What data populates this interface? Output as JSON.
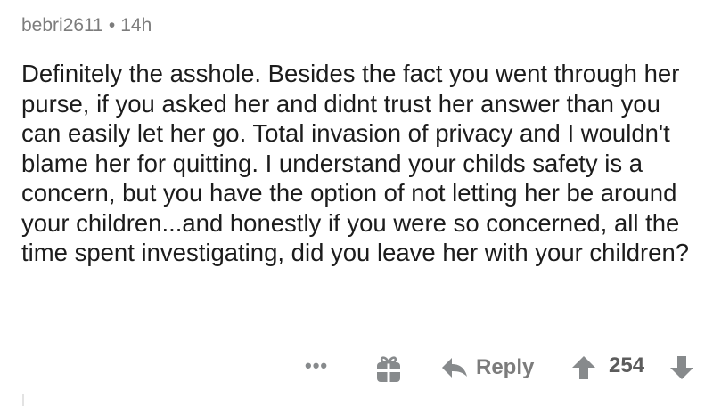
{
  "comment": {
    "author": "bebri2611",
    "separator": "•",
    "age": "14h",
    "text": "Definitely the asshole. Besides the fact you went through her purse, if you asked her and didnt trust her answer than you can easily let her go. Total invasion of privacy and I wouldn't blame her for quitting. I understand your childs safety is a concern, but you have the option of not letting her be around your children...and honestly if you were so concerned, all the time spent investigating, did you leave her with your children?"
  },
  "actions": {
    "more": "•••",
    "gift_icon": "gift-icon",
    "reply_icon": "reply-arrow-icon",
    "reply_label": "Reply",
    "upvote_icon": "upvote-arrow-icon",
    "score": "254",
    "downvote_icon": "downvote-arrow-icon"
  },
  "colors": {
    "meta": "#7c7c7c",
    "text": "#1c1c1c",
    "icon": "#878a8c"
  }
}
